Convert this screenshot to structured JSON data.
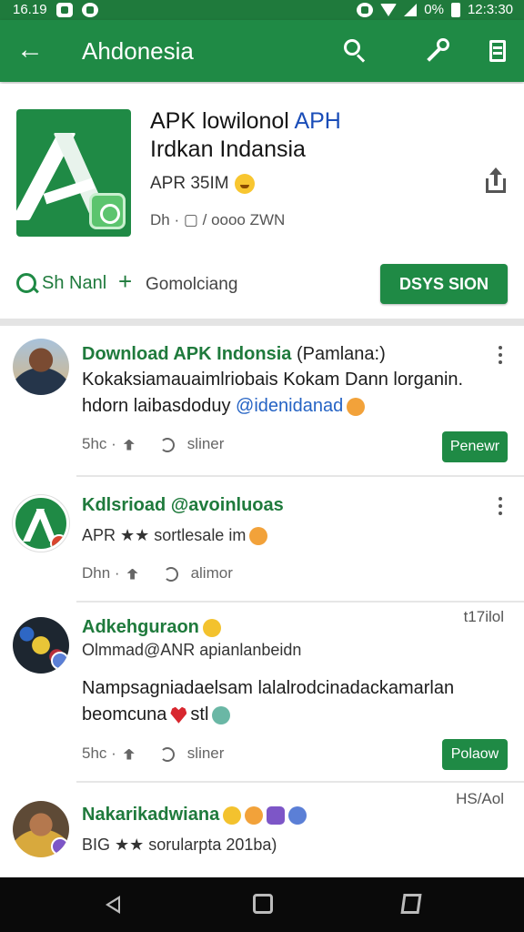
{
  "status_bar": {
    "time_left": "16.19",
    "battery": "0%",
    "clock": "12:3:30"
  },
  "app_bar": {
    "title": "Ahdonesia"
  },
  "app": {
    "name_line1": "APK lowilonol ",
    "name_highlight": "APH",
    "name_line2": "Irdkan Indansia",
    "meta_primary": "APR 35IM",
    "meta_secondary": "Dh · ▢ / oooo ZWN",
    "action_left": "Sh Nanl",
    "action_plus": "+",
    "action_right": "Gomolciang",
    "install_label": "DSYS SION"
  },
  "posts": [
    {
      "title": "Download APK",
      "title_tail": "Indonsia",
      "title_plain": "(Pamlana:)",
      "body_line1": "Kokaksiamauaimlriobais Kokam Dann lorganin.",
      "body_line2": "hdorn laibasdoduy ",
      "body_tag": "@idenidanad",
      "meta_left": "5hc ·",
      "meta_right": "sliner",
      "button_label": "Penewr"
    },
    {
      "title": "Kdlsrioad @avoinluoas",
      "sub": "APR ★★ sortlesale im",
      "meta_left": "Dhn ·",
      "meta_right": "alimor"
    },
    {
      "title": "Adkehguraon",
      "sub": "Olmmad@ANR apianlanbeidn",
      "time": "t17ilol",
      "body_line1": "Nampsagniadaelsam lalalrodcinadackamarlan",
      "body_line2": "beomcuna",
      "body_tail": "stl",
      "meta_left": "5hc ·",
      "meta_right": "sliner",
      "button_label": "Polaow"
    },
    {
      "title": "Nakarikadwiana",
      "sub": "BIG ★★ sorularpta 201ba)",
      "time": "HS/Aol"
    }
  ]
}
